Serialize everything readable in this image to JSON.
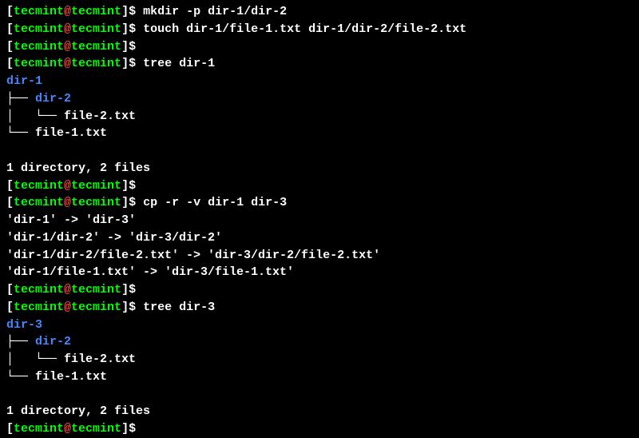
{
  "prompt": {
    "open_bracket": "[",
    "close_bracket": "]",
    "user": "tecmint",
    "at": "@",
    "host": "tecmint",
    "dollar": "$"
  },
  "commands": {
    "mkdir": "mkdir -p dir-1/dir-2",
    "touch": "touch dir-1/file-1.txt dir-1/dir-2/file-2.txt",
    "tree1": "tree dir-1",
    "cp": "cp -r -v dir-1 dir-3",
    "tree2": "tree dir-3",
    "empty": ""
  },
  "tree1": {
    "root": "dir-1",
    "l1": "├── ",
    "dir2": "dir-2",
    "l2": "│   └── ",
    "file2": "file-2.txt",
    "l3": "└── ",
    "file1": "file-1.txt",
    "summary": "1 directory, 2 files"
  },
  "cp_output": {
    "l1": "'dir-1' -> 'dir-3'",
    "l2": "'dir-1/dir-2' -> 'dir-3/dir-2'",
    "l3": "'dir-1/dir-2/file-2.txt' -> 'dir-3/dir-2/file-2.txt'",
    "l4": "'dir-1/file-1.txt' -> 'dir-3/file-1.txt'"
  },
  "tree2": {
    "root": "dir-3",
    "l1": "├── ",
    "dir2": "dir-2",
    "l2": "│   └── ",
    "file2": "file-2.txt",
    "l3": "└── ",
    "file1": "file-1.txt",
    "summary": "1 directory, 2 files"
  }
}
